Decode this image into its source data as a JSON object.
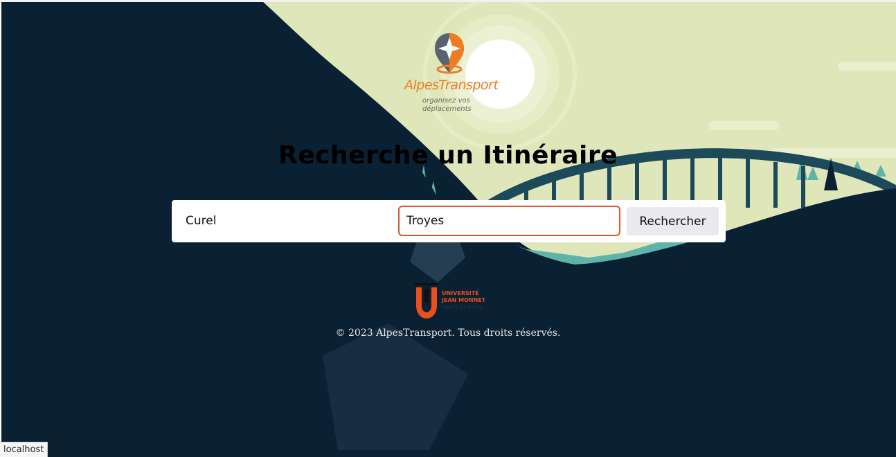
{
  "logo": {
    "name": "AlpesTransport",
    "tagline_line1": "organisez vos",
    "tagline_line2": "déplacements",
    "icon": "map-pin-compass-icon"
  },
  "page_title": "Recherche un Itinéraire",
  "search": {
    "from_value": "Curel",
    "to_value": "Troyes",
    "button_label": "Rechercher"
  },
  "university_logo": {
    "line1": "UNIVERSITÉ",
    "line2": "JEAN MONNET",
    "line3": "SAINT-ÉTIENNE"
  },
  "footer": {
    "copyright": "© 2023 AlpesTransport. Tous droits réservés."
  },
  "status_bar": {
    "url": "localhost"
  },
  "colors": {
    "background": "#0a2033",
    "sky": "#dfe6b9",
    "accent": "#ef7d1f",
    "input_focus_border": "#d7582a",
    "bridge": "#1c4a5a",
    "trees": "#5fb3a8"
  }
}
